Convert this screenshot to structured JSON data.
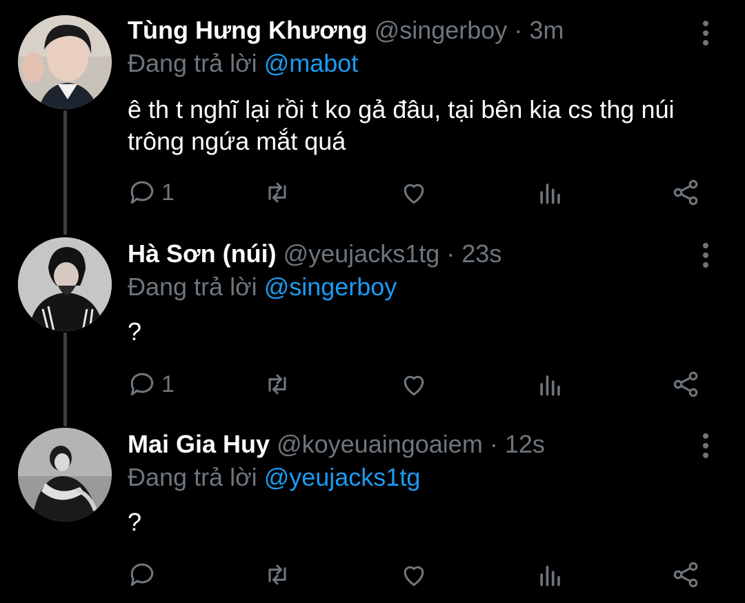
{
  "tweets": [
    {
      "name": "Tùng Hưng Khương",
      "handle": "@singerboy",
      "dot": "·",
      "time": "3m",
      "replying_prefix": "Đang trả lời ",
      "replying_to": "@mabot",
      "text": "ê th t nghĩ lại rồi t ko gả đâu, tại bên kia cs thg núi trông ngứa mắt quá",
      "reply_count": "1"
    },
    {
      "name": "Hà Sơn (núi)",
      "handle": "@yeujacks1tg",
      "dot": "·",
      "time": "23s",
      "replying_prefix": "Đang trả lời ",
      "replying_to": "@singerboy",
      "text": "?",
      "reply_count": "1"
    },
    {
      "name": "Mai Gia Huy",
      "handle": "@koyeuaingoaiem",
      "dot": "·",
      "time": "12s",
      "replying_prefix": "Đang trả lời ",
      "replying_to": "@yeujacks1tg",
      "text": "?",
      "reply_count": ""
    }
  ],
  "colors": {
    "background": "#000000",
    "text": "#ffffff",
    "muted": "#6e767d",
    "link": "#1d9bf0",
    "thread_line": "#3a3e42"
  },
  "icons": [
    "reply-icon",
    "retweet-icon",
    "like-icon",
    "analytics-icon",
    "share-icon",
    "more-icon"
  ]
}
